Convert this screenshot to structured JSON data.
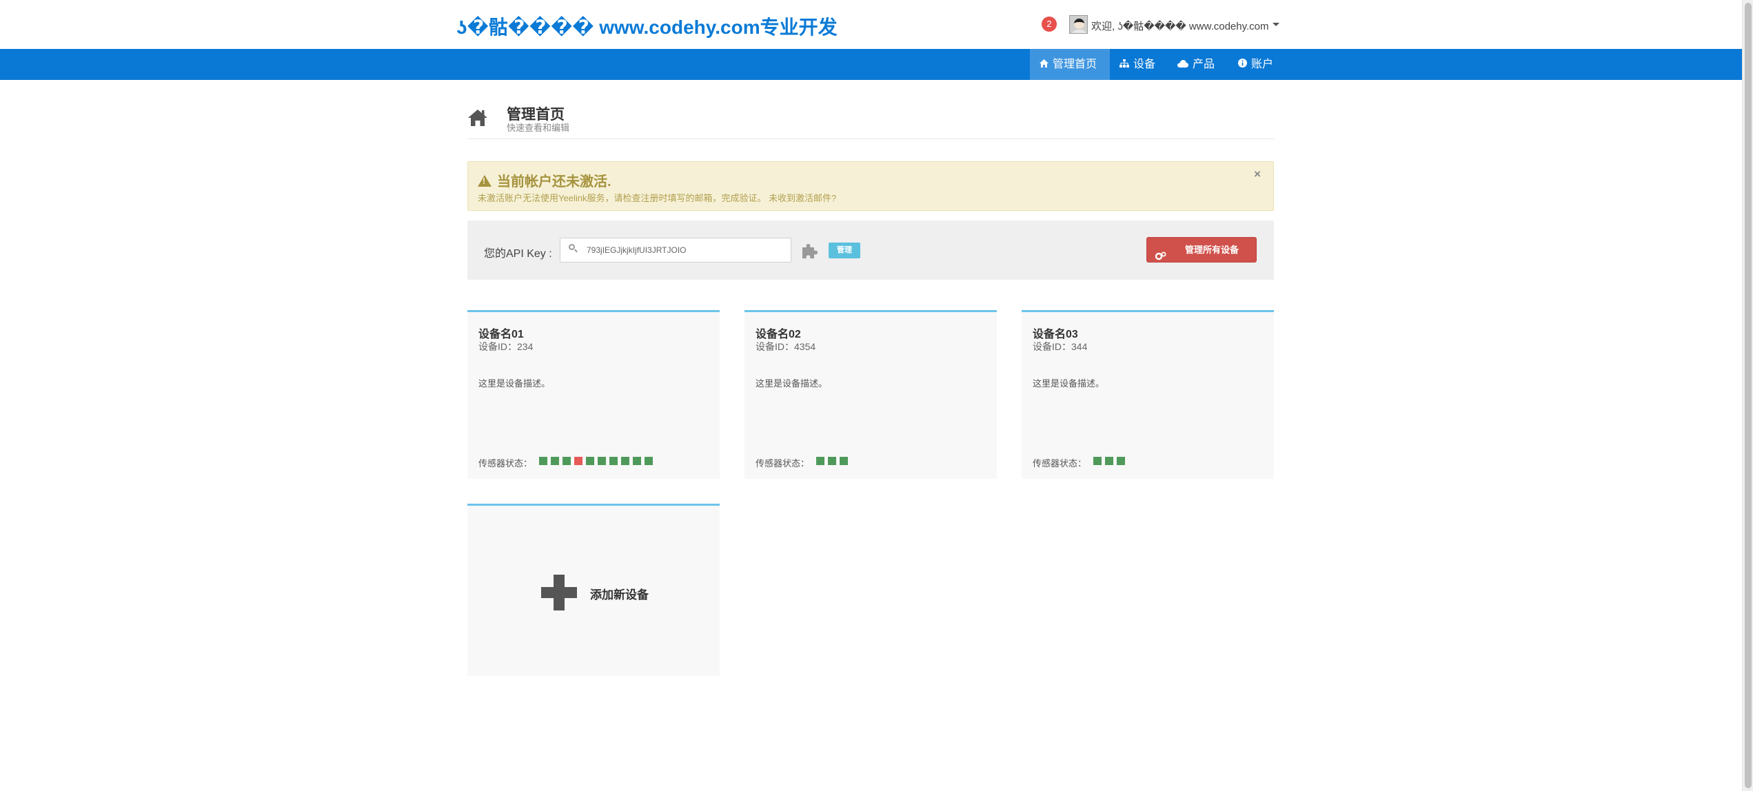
{
  "header": {
    "brand": "ʖ�骷���� www.codehy.com专业开发",
    "notification_count": "2",
    "welcome": "欢迎, ʖ�骷���� www.codehy.com"
  },
  "nav": {
    "items": [
      {
        "label": "管理首页",
        "icon": "home-icon",
        "active": true
      },
      {
        "label": "设备",
        "icon": "sitemap-icon",
        "active": false
      },
      {
        "label": "产品",
        "icon": "cloud-icon",
        "active": false
      },
      {
        "label": "账户",
        "icon": "info-icon",
        "active": false
      }
    ]
  },
  "page": {
    "title": "管理首页",
    "subtitle": "快速查看和编辑"
  },
  "alert": {
    "title": "当前帐户还未激活.",
    "text": "未激活账户无法使用Yeelink服务，请检查注册时填写的邮箱，完成验证。 未收到激活邮件?",
    "close": "×"
  },
  "api": {
    "label": "您的API Key :",
    "value": "793jIEGJjkjkIjfUI3JRTJOIO",
    "manage_tag": "管理",
    "manage_all_button": "管理所有设备"
  },
  "devices": [
    {
      "name": "设备名01",
      "id_text": "设备ID：234",
      "desc": "这里是设备描述。",
      "sensor_label": "传感器状态：",
      "sensors": [
        "ok",
        "ok",
        "ok",
        "bad",
        "ok",
        "ok",
        "ok",
        "ok",
        "ok",
        "ok"
      ]
    },
    {
      "name": "设备名02",
      "id_text": "设备ID：4354",
      "desc": "这里是设备描述。",
      "sensor_label": "传感器状态：",
      "sensors": [
        "ok",
        "ok",
        "ok"
      ]
    },
    {
      "name": "设备名03",
      "id_text": "设备ID：344",
      "desc": "这里是设备描述。",
      "sensor_label": "传感器状态：",
      "sensors": [
        "ok",
        "ok",
        "ok"
      ]
    }
  ],
  "add_device": {
    "label": "添加新设备"
  },
  "colors": {
    "primary": "#0a78d5",
    "nav_active": "#3e95df",
    "sensor_ok": "#4f9a5b",
    "sensor_bad": "#e65a58",
    "danger": "#d0514b",
    "info": "#5bc0de"
  }
}
